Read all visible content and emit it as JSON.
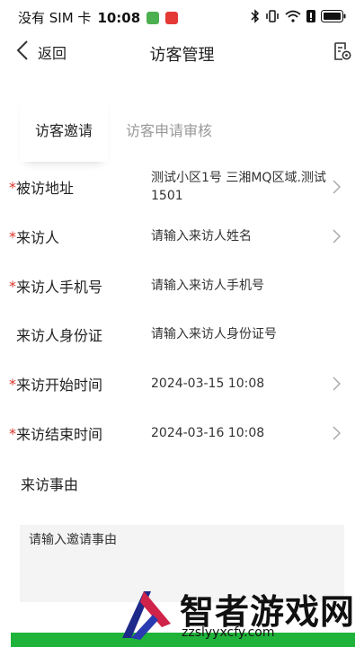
{
  "status_bar": {
    "carrier": "没有 SIM 卡",
    "time": "10:08",
    "badge_colors": [
      "#4caf50",
      "#e53935"
    ]
  },
  "header": {
    "back_label": "返回",
    "title": "访客管理",
    "back_icon": "chevron-left-icon",
    "record_icon": "record-settings-icon"
  },
  "tabs": [
    {
      "label": "访客邀请",
      "active": true
    },
    {
      "label": "访客申请审核",
      "active": false
    }
  ],
  "form": {
    "rows": [
      {
        "label": "被访地址",
        "required": true,
        "value": "测试小区1号 三湘MQ区域.测试1501",
        "has_arrow": true
      },
      {
        "label": "来访人",
        "required": true,
        "value": "请输入来访人姓名",
        "has_arrow": true
      },
      {
        "label": "来访人手机号",
        "required": true,
        "value": "请输入来访人手机号",
        "has_arrow": false
      },
      {
        "label": "来访人身份证",
        "required": false,
        "value": "请输入来访人身份证号",
        "has_arrow": false
      },
      {
        "label": "来访开始时间",
        "required": true,
        "value": "2024-03-15 10:08",
        "has_arrow": true
      },
      {
        "label": "来访结束时间",
        "required": true,
        "value": "2024-03-16 10:08",
        "has_arrow": true
      }
    ],
    "required_mark": "*",
    "reason_label": "来访事由",
    "reason_placeholder": "请输入邀请事由"
  },
  "watermark": {
    "title": "智者游戏网",
    "url": "zzslyyxcfy.com"
  },
  "colors": {
    "required": "#d9342b",
    "inactive_tab": "#999999",
    "bottom_button": "#1fb33a",
    "reason_bg": "#f4f4f4"
  }
}
